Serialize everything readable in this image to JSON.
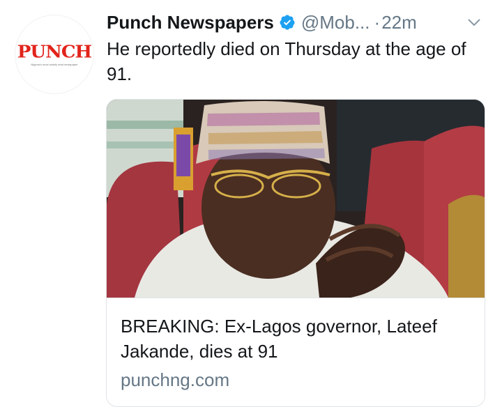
{
  "tweet": {
    "avatar": {
      "logo_text": "PUNCH",
      "tagline": "Nigeria's most widely read newspaper",
      "brand_color": "#e2231a"
    },
    "author_name": "Punch Newspapers",
    "verified_icon": "verified-badge-icon",
    "verified_color": "#1da1f2",
    "handle": "@Mob...",
    "separator": "·",
    "timestamp": "22m",
    "menu_icon": "chevron-down-icon",
    "text": "He reportedly died on Thursday at the age of 91.",
    "card": {
      "image_icon": "news-photo",
      "title": "BREAKING: Ex-Lagos governor, Lateef Jakande, dies at 91",
      "domain": "punchng.com"
    }
  },
  "colors": {
    "text": "#14171a",
    "secondary": "#657786",
    "border": "#dfe3e7"
  }
}
